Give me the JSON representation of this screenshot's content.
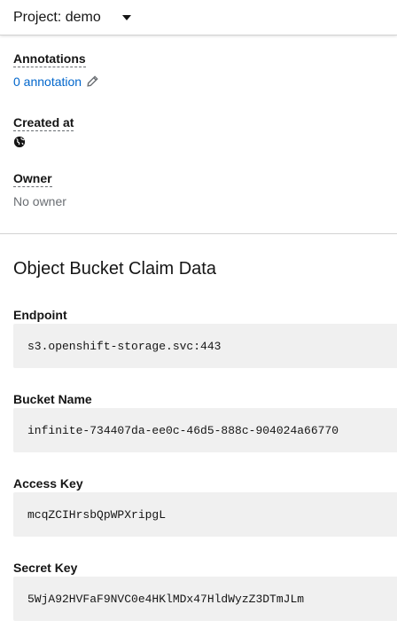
{
  "header": {
    "project_label": "Project: demo",
    "caret_icon": "caret-down-icon"
  },
  "details": {
    "annotations": {
      "label": "Annotations",
      "value": "0 annotation",
      "icon": "pencil-icon"
    },
    "created_at": {
      "label": "Created at",
      "icon": "globe-icon"
    },
    "owner": {
      "label": "Owner",
      "value": "No owner"
    }
  },
  "obc": {
    "title": "Object Bucket Claim Data",
    "fields": [
      {
        "label": "Endpoint",
        "value": "s3.openshift-storage.svc:443"
      },
      {
        "label": "Bucket Name",
        "value": "infinite-734407da-ee0c-46d5-888c-904024a66770"
      },
      {
        "label": "Access Key",
        "value": "mcqZCIHrsbQpWPXripgL"
      },
      {
        "label": "Secret Key",
        "value": "5WjA92HVFaF9NVC0e4HKlMDx47HldWyzZ3DTmJLm"
      }
    ]
  },
  "colors": {
    "link": "#0066cc",
    "muted": "#6a6e73",
    "code_bg": "#f0f0f0"
  }
}
